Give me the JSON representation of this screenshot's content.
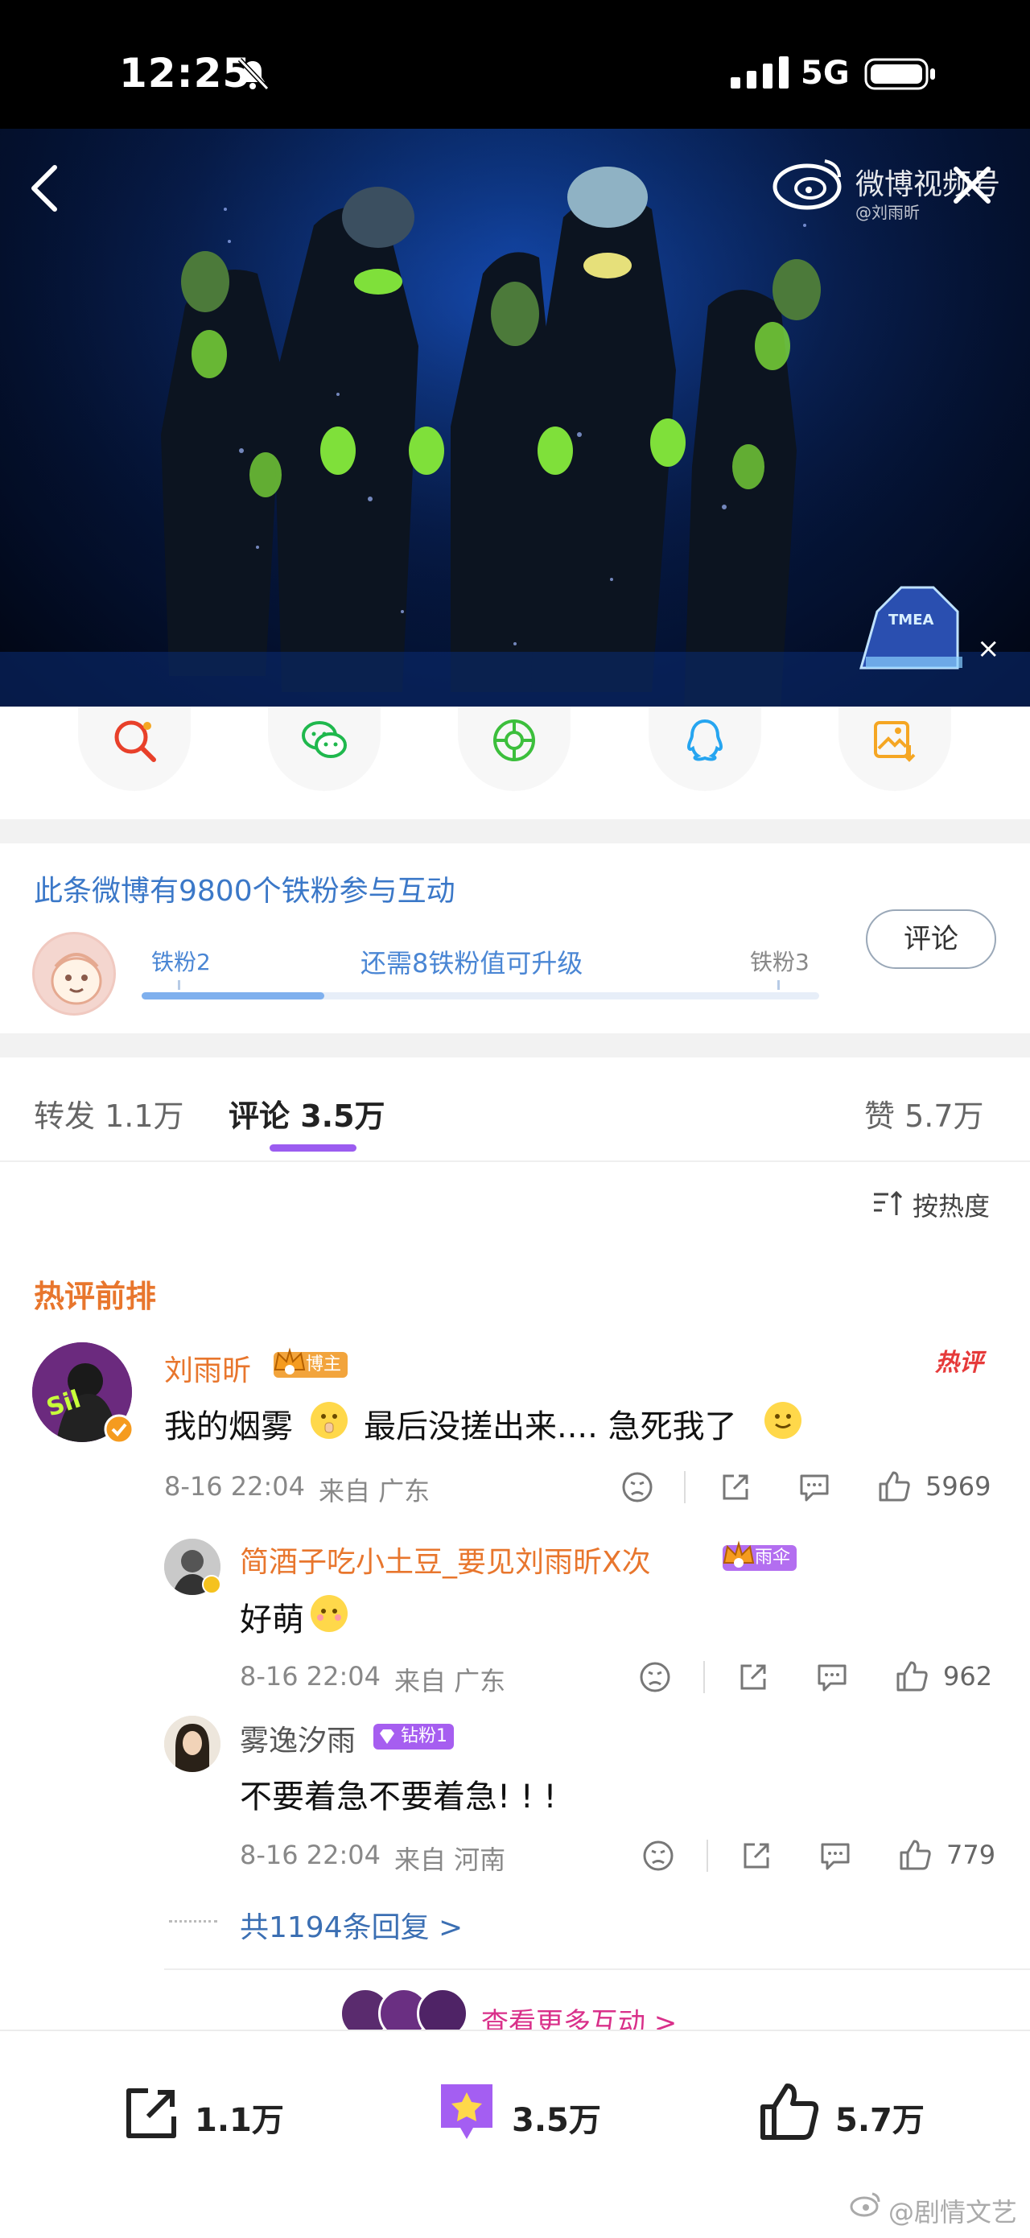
{
  "status_bar": {
    "time": "12:25",
    "network": "5G"
  },
  "video": {
    "brand_title": "微博视频号",
    "brand_sub": "@刘雨昕",
    "badge": "TMEA"
  },
  "share_icons": [
    "weibo-search-icon",
    "wechat-icon",
    "moments-icon",
    "qq-icon",
    "save-image-icon"
  ],
  "fans": {
    "title": "此条微博有9800个铁粉参与互动",
    "level_current": "铁粉2",
    "level_next": "铁粉3",
    "progress_text": "还需8铁粉值可升级",
    "progress": 0.27,
    "comment_button": "评论"
  },
  "tabs": {
    "repost": "转发 1.1万",
    "comments": "评论 3.5万",
    "likes": "赞 5.7万"
  },
  "sort_label": "按热度",
  "hot_section_title": "热评前排",
  "comments": [
    {
      "user": "刘雨昕",
      "tag": "博主",
      "hot_badge": "热评",
      "text": "我的烟雾",
      "text2": "最后没搓出来.... 急死我了",
      "time": "8-16 22:04",
      "source": "来自 广东",
      "likes": "5969"
    }
  ],
  "replies": [
    {
      "user": "简酒子吃小土豆_要见刘雨昕X次",
      "tag": "雨伞",
      "text": "好萌",
      "time": "8-16 22:04",
      "source": "来自 广东",
      "likes": "962"
    },
    {
      "user": "雾逸汐雨",
      "tag": "钻粉1",
      "text": "不要着急不要着急! ! !",
      "time": "8-16 22:04",
      "source": "来自 河南",
      "likes": "779"
    }
  ],
  "more_replies": "共1194条回复 >",
  "more_interactions": "查看更多互动 >",
  "bottom_bar": {
    "repost_count": "1.1万",
    "comment_count": "3.5万",
    "like_count": "5.7万"
  },
  "watermark": "@剧情文艺",
  "colors": {
    "accent_orange": "#e8762d",
    "accent_purple": "#9b5cf0",
    "link_blue": "#3b6fb3",
    "hot_red": "#e63a3a"
  }
}
